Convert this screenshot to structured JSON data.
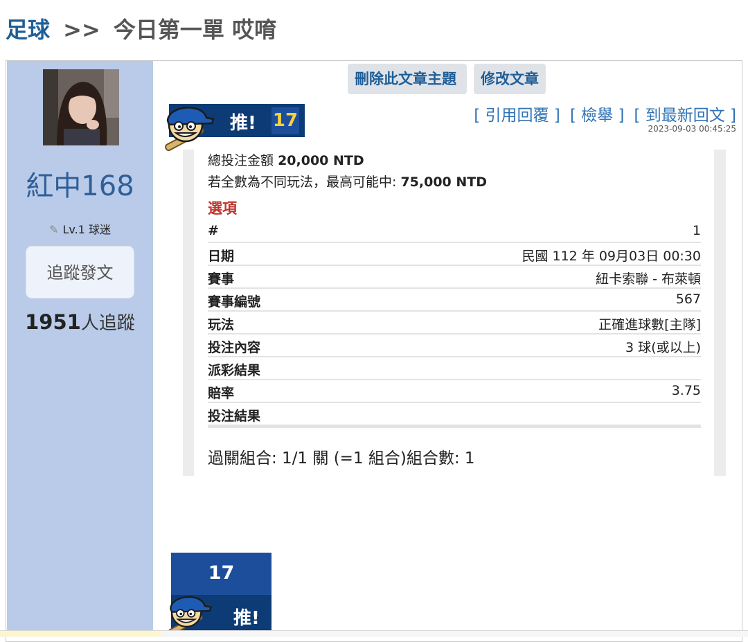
{
  "breadcrumb": {
    "board": "足球",
    "separator": ">>",
    "title": "今日第一單 哎唷"
  },
  "user": {
    "name": "紅中168",
    "level": "Lv.1 球迷",
    "follow_label": "追蹤發文",
    "followers_count": "1951",
    "followers_suffix": "人追蹤"
  },
  "actions": {
    "delete_topic": "刪除此文章主題",
    "edit_post": "修改文章"
  },
  "post_links": {
    "quote_reply": "[ 引用回覆 ]",
    "report": "[ 檢舉 ]",
    "latest_reply": "[ 到最新回文 ]"
  },
  "timestamp": "2023-09-03 00:45:25",
  "push": {
    "label": "推!",
    "count": "17"
  },
  "bet": {
    "total_label": "總投注金額",
    "total_value": "20,000 NTD",
    "max_label": "若全數為不同玩法，最高可能中:",
    "max_value": "75,000 NTD",
    "options_title": "選項",
    "rows": [
      {
        "k": "#",
        "v": "1"
      },
      {
        "k": "日期",
        "v": "民國 112 年 09月03日 00:30"
      },
      {
        "k": "賽事",
        "v": "紐卡索聯 - 布萊頓"
      },
      {
        "k": "賽事編號",
        "v": "567"
      },
      {
        "k": "玩法",
        "v": "正確進球數[主隊]"
      },
      {
        "k": "投注內容",
        "v": "3 球(或以上)"
      },
      {
        "k": "派彩結果",
        "v": ""
      },
      {
        "k": "賠率",
        "v": "3.75"
      },
      {
        "k": "投注結果",
        "v": ""
      }
    ],
    "parlay": "過關組合: 1/1 關 (=1 組合)組合數: 1"
  },
  "colors": {
    "sidebar": "#b9cbe9",
    "link": "#2f73b5",
    "brand_dark": "#0c3b75",
    "brand": "#1d4e9c",
    "accent_yellow": "#f7d23a",
    "options_red": "#c0352c"
  }
}
